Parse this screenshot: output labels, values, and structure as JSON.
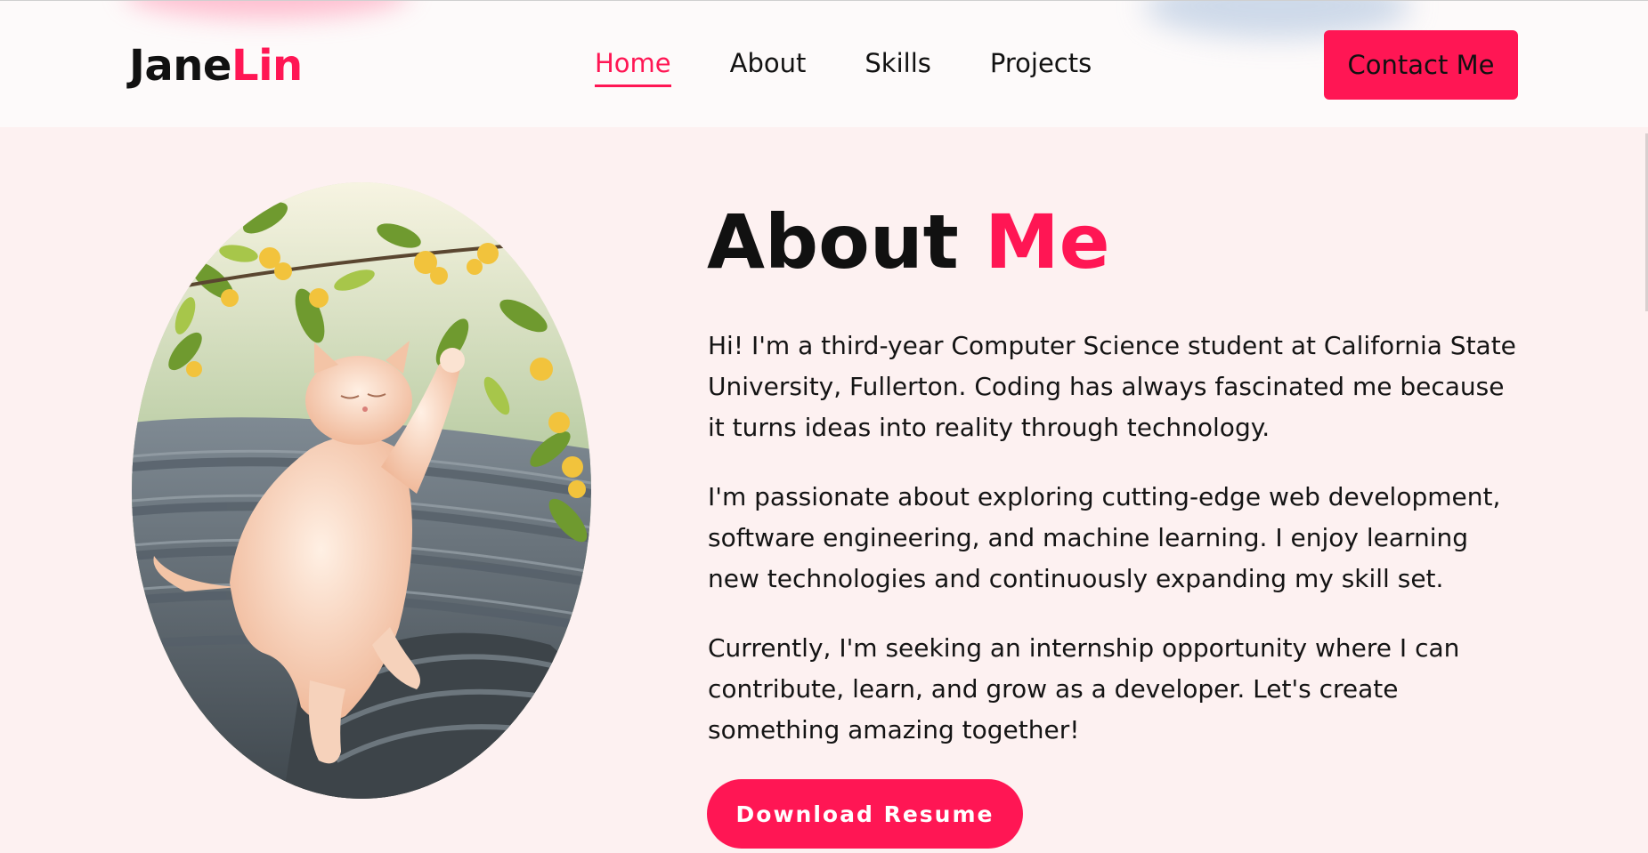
{
  "header": {
    "logo_first": "Jane",
    "logo_last": "Lin",
    "nav": [
      {
        "label": "Home",
        "active": true
      },
      {
        "label": "About",
        "active": false
      },
      {
        "label": "Skills",
        "active": false
      },
      {
        "label": "Projects",
        "active": false
      }
    ],
    "contact_label": "Contact Me"
  },
  "about": {
    "title_word1": "About",
    "title_word2": "Me",
    "paragraphs": [
      "Hi! I'm a third-year Computer Science student at California State University, Fullerton. Coding has always fascinated me because it turns ideas into reality through technology.",
      "I'm passionate about exploring cutting-edge web development, software engineering, and machine learning. I enjoy learning new technologies and continuously expanding my skill set.",
      "Currently, I'm seeking an internship opportunity where I can contribute, learn, and grow as a developer. Let's create something amazing together!"
    ],
    "resume_label": "Download Resume"
  },
  "icons": {
    "photo": "cat-photo"
  },
  "colors": {
    "accent": "#ff1654",
    "background": "#fdf1f1",
    "header_background": "#fdfafa",
    "text": "#111111"
  }
}
